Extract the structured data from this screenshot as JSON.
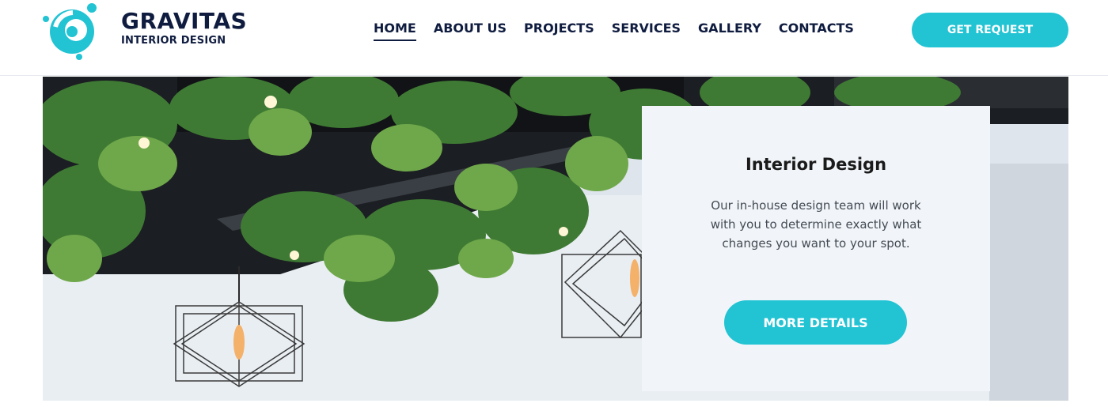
{
  "brand": {
    "name": "GRAVITAS",
    "tagline": "INTERIOR DESIGN",
    "accent_color": "#22c3d3",
    "text_color": "#0f1c3f"
  },
  "nav": {
    "items": [
      {
        "label": "HOME",
        "active": true
      },
      {
        "label": "ABOUT US",
        "active": false
      },
      {
        "label": "PROJECTS",
        "active": false
      },
      {
        "label": "SERVICES",
        "active": false
      },
      {
        "label": "GALLERY",
        "active": false
      },
      {
        "label": "CONTACTS",
        "active": false
      }
    ]
  },
  "header": {
    "cta_label": "GET REQUEST"
  },
  "hero": {
    "image_subject": "ceiling-plants-pendant-lamps-photo",
    "card": {
      "title": "Interior Design",
      "text": "Our in-house design team will work with you to determine exactly what changes you want to your spot.",
      "button_label": "MORE DETAILS"
    }
  }
}
